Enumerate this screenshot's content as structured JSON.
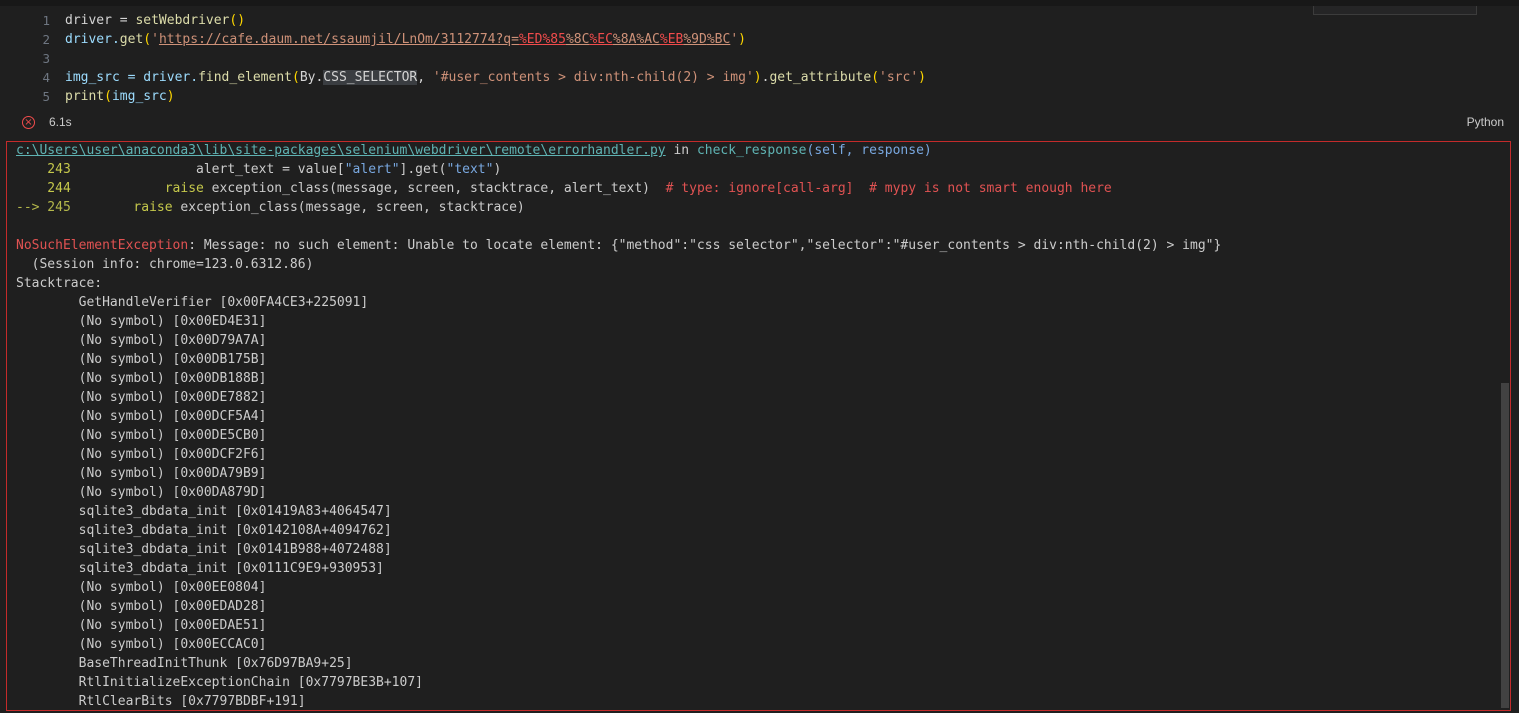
{
  "code": [
    {
      "num": "1",
      "parts": [
        [
          "driver = ",
          ""
        ],
        [
          "setWebdriver",
          "t-fn"
        ],
        [
          "()",
          "t-paren"
        ]
      ]
    },
    {
      "num": "2",
      "parts": [
        [
          "driver.",
          "t-var"
        ],
        [
          "get",
          "t-fn"
        ],
        [
          "(",
          "t-paren"
        ],
        [
          "'",
          "t-str"
        ],
        [
          "https://cafe.daum.net/ssaumjil/LnOm/3112774?q=",
          "t-link"
        ],
        [
          "%ED",
          "t-esc"
        ],
        [
          "%85",
          "t-esc"
        ],
        [
          "%8C",
          "t-link"
        ],
        [
          "%EC",
          "t-esc"
        ],
        [
          "%8A",
          "t-link"
        ],
        [
          "%AC",
          "t-link"
        ],
        [
          "%EB",
          "t-esc"
        ],
        [
          "%9D",
          "t-link"
        ],
        [
          "%BC",
          "t-link"
        ],
        [
          "'",
          "t-str"
        ],
        [
          ")",
          "t-paren"
        ]
      ]
    },
    {
      "num": "3",
      "parts": []
    },
    {
      "num": "4",
      "parts": [
        [
          "img_src = driver.",
          "t-var"
        ],
        [
          "find_element",
          "t-fn"
        ],
        [
          "(",
          "t-paren"
        ],
        [
          "By.",
          ""
        ],
        [
          "CSS_SELECTOR",
          "t-sel"
        ],
        [
          ", ",
          ""
        ],
        [
          "'#user_contents > div:nth-child(2) > img'",
          "t-str"
        ],
        [
          ")",
          "t-paren"
        ],
        [
          ".",
          ""
        ],
        [
          "get_attribute",
          "t-fn"
        ],
        [
          "(",
          "t-paren"
        ],
        [
          "'src'",
          "t-str"
        ],
        [
          ")",
          "t-paren"
        ]
      ]
    },
    {
      "num": "5",
      "parts": [
        [
          "print",
          "t-fn"
        ],
        [
          "(",
          "t-paren"
        ],
        [
          "img_src",
          "t-var"
        ],
        [
          ")",
          "t-paren"
        ]
      ]
    }
  ],
  "status": {
    "exec_time": "6.1s",
    "language": "Python"
  },
  "output": [
    [
      [
        "c:\\Users\\user\\anaconda3\\lib\\site-packages\\selenium\\webdriver\\remote\\errorhandler.py",
        "o-path"
      ],
      [
        " in ",
        ""
      ],
      [
        "check_response",
        "o-fn"
      ],
      [
        "(self, response)",
        "o-args"
      ]
    ],
    [
      [
        "    243",
        "o-num"
      ],
      [
        "                alert_text = value[",
        ""
      ],
      [
        "\"alert\"",
        "o-str"
      ],
      [
        "].get(",
        ""
      ],
      [
        "\"text\"",
        "o-str"
      ],
      [
        ")",
        ""
      ]
    ],
    [
      [
        "    244",
        "o-num"
      ],
      [
        "            ",
        ""
      ],
      [
        "raise",
        "o-kw"
      ],
      [
        " exception_class(message, screen, stacktrace, alert_text)  ",
        ""
      ],
      [
        "# type: ignore[call-arg]  # mypy is not smart enough here",
        "o-comment"
      ]
    ],
    [
      [
        "--> 245",
        "o-arrow"
      ],
      [
        "        ",
        ""
      ],
      [
        "raise",
        "o-kw"
      ],
      [
        " exception_class(message, screen, stacktrace)",
        ""
      ]
    ],
    [],
    [
      [
        "NoSuchElementException",
        "o-err"
      ],
      [
        ": Message: no such element: Unable to locate element: {\"method\":\"css selector\",\"selector\":\"#user_contents > div:nth-child(2) > img\"}",
        ""
      ]
    ],
    [
      [
        "  (Session info: chrome=123.0.6312.86)",
        ""
      ]
    ],
    [
      [
        "Stacktrace:",
        ""
      ]
    ],
    [
      [
        "        GetHandleVerifier [0x00FA4CE3+225091]",
        ""
      ]
    ],
    [
      [
        "        (No symbol) [0x00ED4E31]",
        ""
      ]
    ],
    [
      [
        "        (No symbol) [0x00D79A7A]",
        ""
      ]
    ],
    [
      [
        "        (No symbol) [0x00DB175B]",
        ""
      ]
    ],
    [
      [
        "        (No symbol) [0x00DB188B]",
        ""
      ]
    ],
    [
      [
        "        (No symbol) [0x00DE7882]",
        ""
      ]
    ],
    [
      [
        "        (No symbol) [0x00DCF5A4]",
        ""
      ]
    ],
    [
      [
        "        (No symbol) [0x00DE5CB0]",
        ""
      ]
    ],
    [
      [
        "        (No symbol) [0x00DCF2F6]",
        ""
      ]
    ],
    [
      [
        "        (No symbol) [0x00DA79B9]",
        ""
      ]
    ],
    [
      [
        "        (No symbol) [0x00DA879D]",
        ""
      ]
    ],
    [
      [
        "        sqlite3_dbdata_init [0x01419A83+4064547]",
        ""
      ]
    ],
    [
      [
        "        sqlite3_dbdata_init [0x0142108A+4094762]",
        ""
      ]
    ],
    [
      [
        "        sqlite3_dbdata_init [0x0141B988+4072488]",
        ""
      ]
    ],
    [
      [
        "        sqlite3_dbdata_init [0x0111C9E9+930953]",
        ""
      ]
    ],
    [
      [
        "        (No symbol) [0x00EE0804]",
        ""
      ]
    ],
    [
      [
        "        (No symbol) [0x00EDAD28]",
        ""
      ]
    ],
    [
      [
        "        (No symbol) [0x00EDAE51]",
        ""
      ]
    ],
    [
      [
        "        (No symbol) [0x00ECCAC0]",
        ""
      ]
    ],
    [
      [
        "        BaseThreadInitThunk [0x76D97BA9+25]",
        ""
      ]
    ],
    [
      [
        "        RtlInitializeExceptionChain [0x7797BE3B+107]",
        ""
      ]
    ],
    [
      [
        "        RtlClearBits [0x7797BDBF+191]",
        ""
      ]
    ]
  ]
}
